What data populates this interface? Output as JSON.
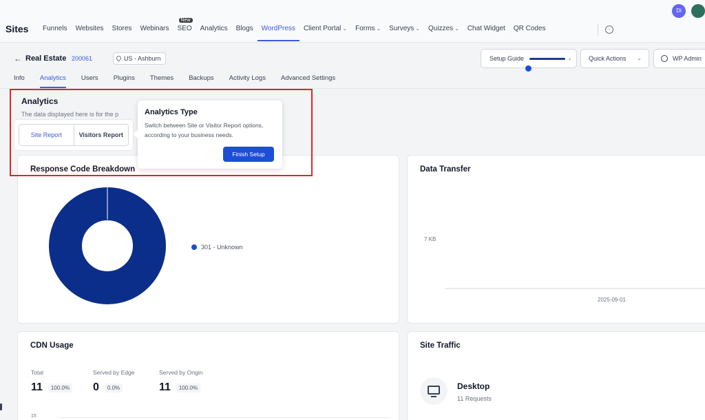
{
  "brand": "Sites",
  "nav": [
    {
      "label": "Funnels"
    },
    {
      "label": "Websites"
    },
    {
      "label": "Stores"
    },
    {
      "label": "Webinars"
    },
    {
      "label": "SEO",
      "badge": "New"
    },
    {
      "label": "Analytics"
    },
    {
      "label": "Blogs"
    },
    {
      "label": "WordPress",
      "active": true
    },
    {
      "label": "Client Portal",
      "dropdown": true
    },
    {
      "label": "Forms",
      "dropdown": true
    },
    {
      "label": "Surveys",
      "dropdown": true
    },
    {
      "label": "Quizzes",
      "dropdown": true
    },
    {
      "label": "Chat Widget"
    },
    {
      "label": "QR Codes"
    }
  ],
  "user": {
    "avatar_initials": "Di"
  },
  "header": {
    "site_name": "Real Estate",
    "site_id": "200061",
    "location": "US - Ashburn",
    "setup_guide": "Setup Guide",
    "quick_actions": "Quick Actions",
    "wp_admin": "WP Admin"
  },
  "tabs": [
    {
      "label": "Info"
    },
    {
      "label": "Analytics",
      "active": true
    },
    {
      "label": "Users"
    },
    {
      "label": "Plugins"
    },
    {
      "label": "Themes"
    },
    {
      "label": "Backups"
    },
    {
      "label": "Activity Logs"
    },
    {
      "label": "Advanced Settings"
    }
  ],
  "analytics": {
    "title": "Analytics",
    "description": "The data displayed here is for the p",
    "site_report": "Site Report",
    "visitors_report": "Visitors Report"
  },
  "popover": {
    "title": "Analytics Type",
    "body": "Switch between Site or Visitor Report options, according to your business needs.",
    "button": "Finish Setup"
  },
  "response_card": {
    "title": "Response Code Breakdown",
    "legend": "301 - Unknown",
    "color": "#0b2e8a"
  },
  "transfer_card": {
    "title": "Data Transfer",
    "y_tick": "7 KB",
    "x_tick": "2025-09-01"
  },
  "cdn_card": {
    "title": "CDN Usage",
    "stats": [
      {
        "label": "Total",
        "value": "11",
        "pct": "100.0%"
      },
      {
        "label": "Served by Edge",
        "value": "0",
        "pct": "0.0%"
      },
      {
        "label": "Served by Origin",
        "value": "11",
        "pct": "100.0%"
      }
    ],
    "y_tick": "15"
  },
  "traffic_card": {
    "title": "Site Traffic",
    "device": "Desktop",
    "requests": "11 Requests"
  }
}
